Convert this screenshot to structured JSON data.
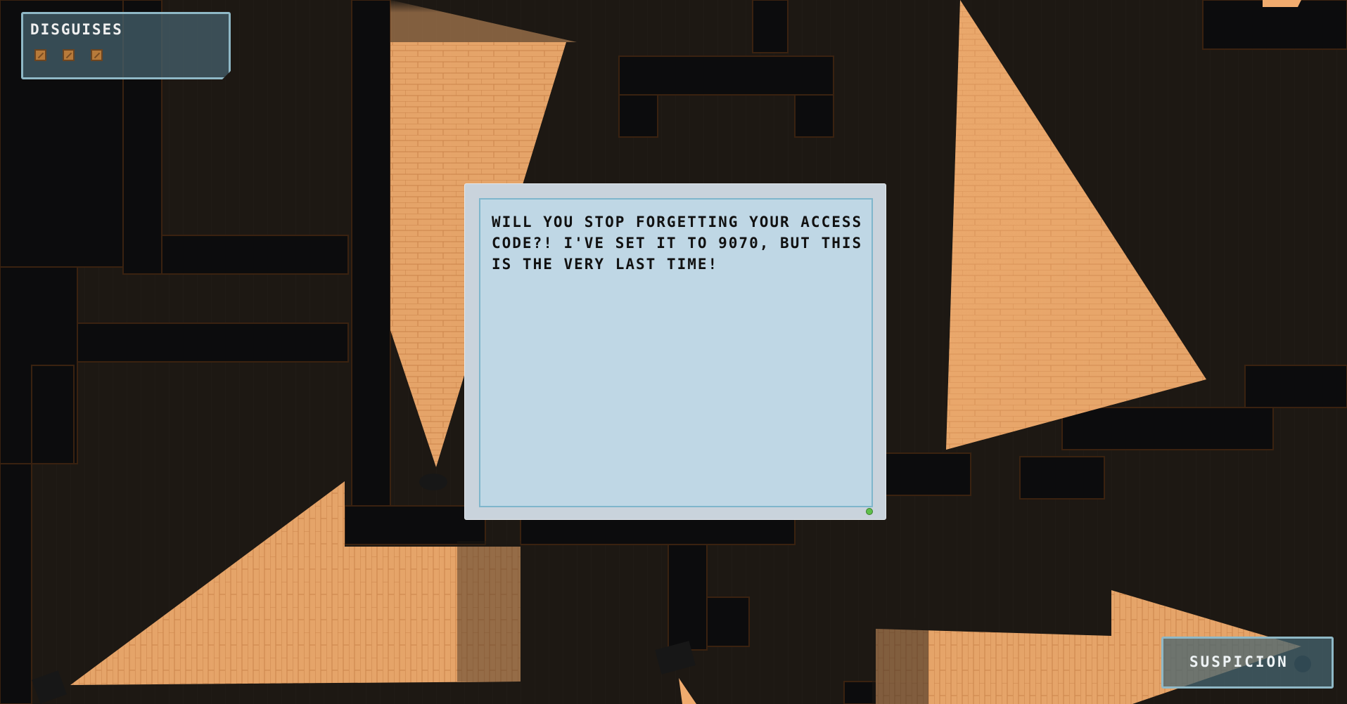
{
  "hud": {
    "disguises": {
      "title": "DISGUISES",
      "slots": [
        "disguise",
        "disguise",
        "disguise"
      ]
    },
    "suspicion": {
      "label": "SUSPICION",
      "level": 0
    }
  },
  "dialog": {
    "message": "WILL YOU STOP FORGETTING YOUR ACCESS CODE?! I'VE SET IT TO 9070, BUT THIS IS THE VERY LAST TIME!",
    "status_color": "#5ec04a"
  },
  "colors": {
    "light_cone": "#f2ae70",
    "floor_dark": "#1a1612",
    "wall": "#0b0b0c",
    "panel_border": "#8fb8c6"
  }
}
